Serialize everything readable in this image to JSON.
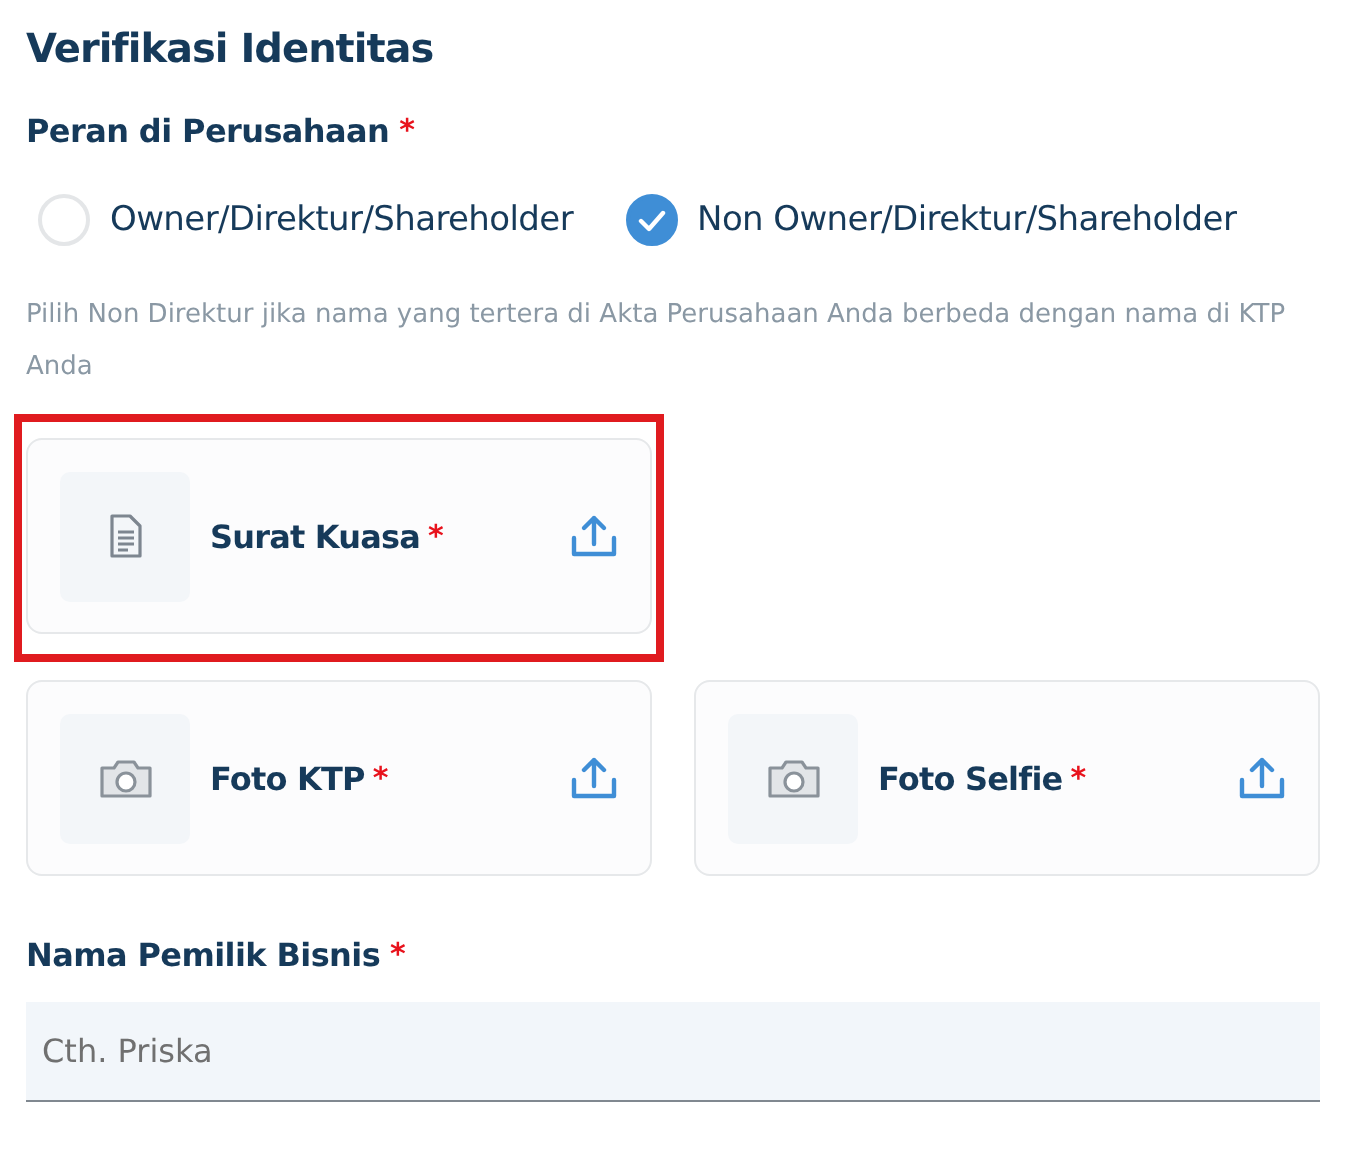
{
  "title": "Verifikasi Identitas",
  "role_field": {
    "label": "Peran di Perusahaan",
    "required_mark": "*",
    "options": [
      {
        "label": "Owner/Direktur/Shareholder",
        "selected": false
      },
      {
        "label": "Non Owner/Direktur/Shareholder",
        "selected": true
      }
    ],
    "hint": "Pilih Non Direktur jika nama yang tertera di Akta Perusahaan Anda berbeda dengan nama di KTP Anda"
  },
  "upload_rows": [
    [
      {
        "kind": "document",
        "label": "Surat Kuasa",
        "required_mark": "*",
        "highlighted": true
      }
    ],
    [
      {
        "kind": "camera",
        "label": "Foto KTP",
        "required_mark": "*",
        "highlighted": false
      },
      {
        "kind": "camera",
        "label": "Foto Selfie",
        "required_mark": "*",
        "highlighted": false
      }
    ]
  ],
  "owner_field": {
    "label": "Nama Pemilik Bisnis",
    "required_mark": "*",
    "placeholder": "Cth. Priska"
  }
}
